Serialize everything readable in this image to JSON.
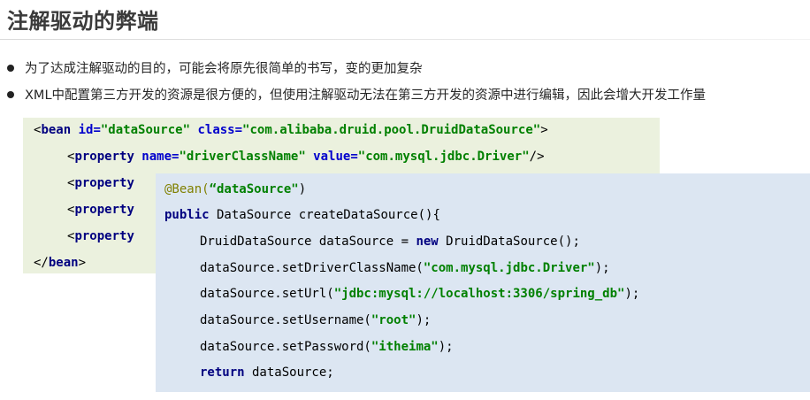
{
  "title": "注解驱动的弊端",
  "bullets": [
    "为了达成注解驱动的目的，可能会将原先很简单的书写，变的更加复杂",
    "XML中配置第三方开发的资源是很方便的，但使用注解驱动无法在第三方开发的资源中进行编辑，因此会增大开发工作量"
  ],
  "xml": {
    "bean_open": "<",
    "bean_tag": "bean",
    "id_attr": " id=",
    "id_val": "\"dataSource\"",
    "class_attr": " class=",
    "class_val": "\"com.alibaba.druid.pool.DruidDataSource\"",
    "bean_open_end": ">",
    "prop_open": "<",
    "prop_tag": "property",
    "name_attr": " name=",
    "name_val": "\"driverClassName\"",
    "value_attr": " value=",
    "value_val": "\"com.mysql.jdbc.Driver\"",
    "prop_close": "/>",
    "bean_close_open": "</",
    "bean_close_tag": "bean",
    "bean_close_end": ">"
  },
  "java": {
    "annotation": "@Bean(",
    "annotation_arg": "“dataSource\"",
    "annotation_end": ")",
    "kw_public": "public",
    "method_sig": " DataSource createDataSource(){",
    "line3_a": "DruidDataSource dataSource = ",
    "kw_new": "new",
    "line3_b": " DruidDataSource();",
    "line4_a": "dataSource.setDriverClassName(",
    "line4_s": "\"com.mysql.jdbc.Driver\"",
    "line4_b": ");",
    "line5_a": "dataSource.setUrl(",
    "line5_s": "\"jdbc:mysql://localhost:3306/spring_db\"",
    "line5_b": ");",
    "line6_a": "dataSource.setUsername(",
    "line6_s": "\"root\"",
    "line6_b": ");",
    "line7_a": "dataSource.setPassword(",
    "line7_s": "\"itheima\"",
    "line7_b": ");",
    "kw_return": "return",
    "line8_b": " dataSource;"
  }
}
